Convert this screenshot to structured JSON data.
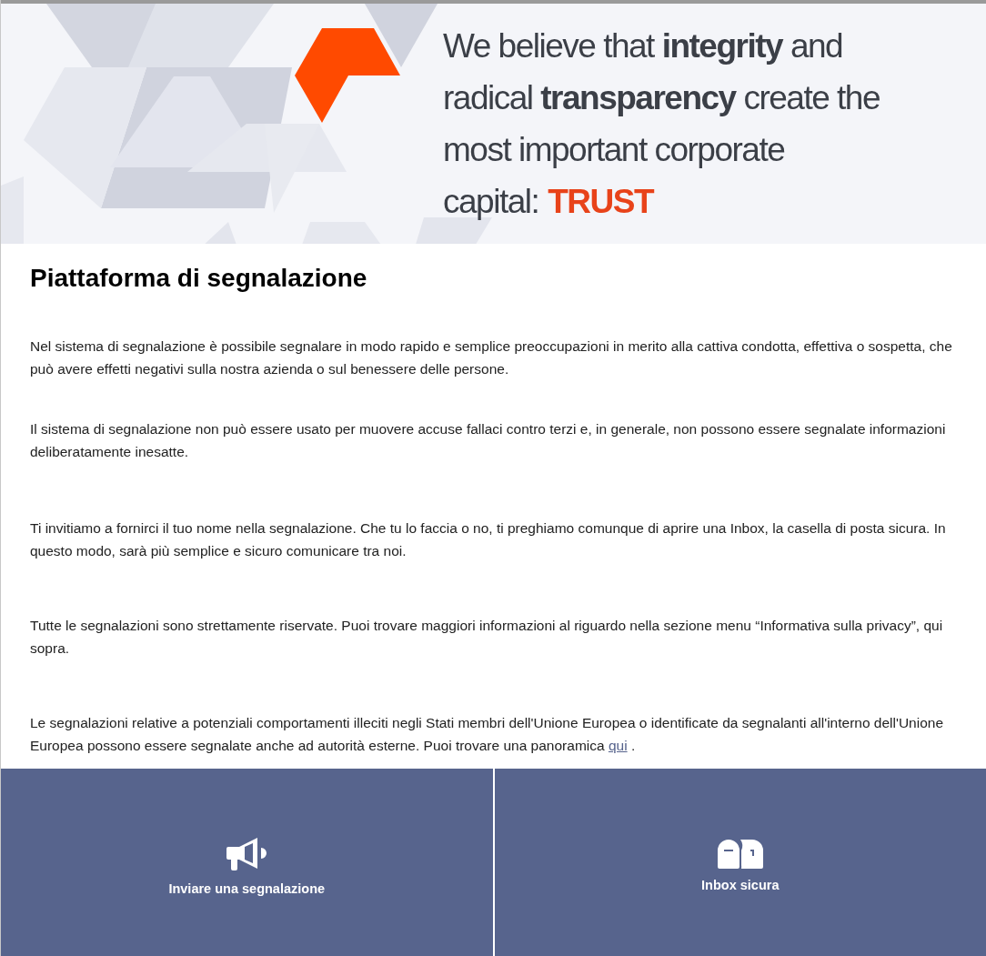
{
  "banner": {
    "lines": [
      "We believe that **integrity** and",
      "radical **transparency** create the",
      "most important corporate",
      "capital:"
    ],
    "highlight": "TRUST"
  },
  "title": "Piattaforma di segnalazione",
  "paragraphs": [
    {
      "text": "Nel sistema di segnalazione è possibile segnalare in modo rapido e semplice preoccupazioni in merito alla cattiva condotta, effettiva o sospetta, che può avere effetti negativi sulla nostra azienda o sul benessere delle persone."
    },
    {
      "text": "Il sistema di segnalazione non può essere usato per muovere accuse fallaci contro terzi e, in generale, non possono essere segnalate informazioni deliberatamente inesatte."
    },
    {
      "text": "Ti invitiamo a fornirci il tuo nome nella segnalazione. Che tu lo faccia o no, ti preghiamo comunque di aprire una Inbox, la casella di posta sicura. In questo modo, sarà più semplice e sicuro comunicare tra noi."
    },
    {
      "text": "Tutte le segnalazioni sono strettamente riservate. Puoi trovare maggiori informazioni al riguardo nella sezione menu “Informativa sulla privacy”, qui sopra."
    },
    {
      "text": "Le segnalazioni relative a potenziali comportamenti illeciti negli Stati membri dell'Unione Europea o identificate da segnalanti all'interno dell'Unione Europea possono essere segnalate anche ad autorità esterne. Puoi trovare una panoramica ",
      "link": "qui",
      "after": " ."
    }
  ],
  "tiles": [
    {
      "kind": "megaphone",
      "label": "Inviare una segnalazione"
    },
    {
      "kind": "mailbox",
      "label": "Inbox sicura"
    }
  ]
}
